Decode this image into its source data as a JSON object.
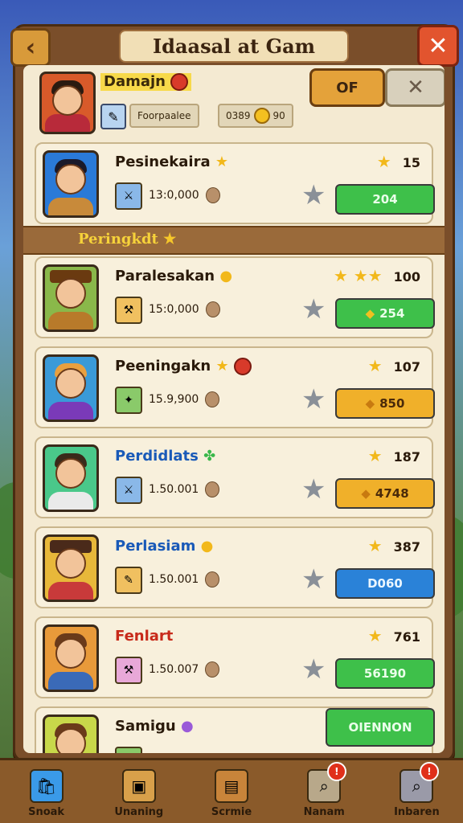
{
  "title": "Idaasal at Gam",
  "me": {
    "name": "Damajn",
    "chip1": "Foorpaalee",
    "chip2_value": "0389",
    "chip2_count": "90",
    "of_label": "OF"
  },
  "section_title": "Peringkdt",
  "top_row": {
    "name": "Pesinekaira",
    "score": "13:0,000",
    "rating_num": "15",
    "action": "204"
  },
  "rows": [
    {
      "name": "Paralesakan",
      "score": "15:0,000",
      "rating": "100",
      "stars": "★ ★★",
      "action": "254",
      "color": "green"
    },
    {
      "name": "Peeningakn",
      "score": "15.9,900",
      "rating": "107",
      "stars": "★",
      "action": "850",
      "color": "orange"
    },
    {
      "name": "Perdidlats",
      "score": "1.50.001",
      "rating": "187",
      "stars": "★",
      "action": "4748",
      "color": "orange"
    },
    {
      "name": "Perlasiam",
      "score": "1.50.001",
      "rating": "387",
      "stars": "★",
      "action": "D060",
      "color": "blue"
    },
    {
      "name": "Fenlart",
      "score": "1.50.007",
      "rating": "761",
      "stars": "★",
      "action": "56190",
      "color": "green"
    }
  ],
  "last_row": {
    "name": "Samigu",
    "action": "OIENNON"
  },
  "nav": [
    {
      "label": "Snoak",
      "icon": "shop-icon",
      "badge": ""
    },
    {
      "label": "Unaning",
      "icon": "bag-icon",
      "badge": ""
    },
    {
      "label": "Scrmie",
      "icon": "book-icon",
      "badge": ""
    },
    {
      "label": "Nanam",
      "icon": "search-icon",
      "badge": "!"
    },
    {
      "label": "Inbaren",
      "icon": "magnify-icon",
      "badge": "!"
    }
  ]
}
